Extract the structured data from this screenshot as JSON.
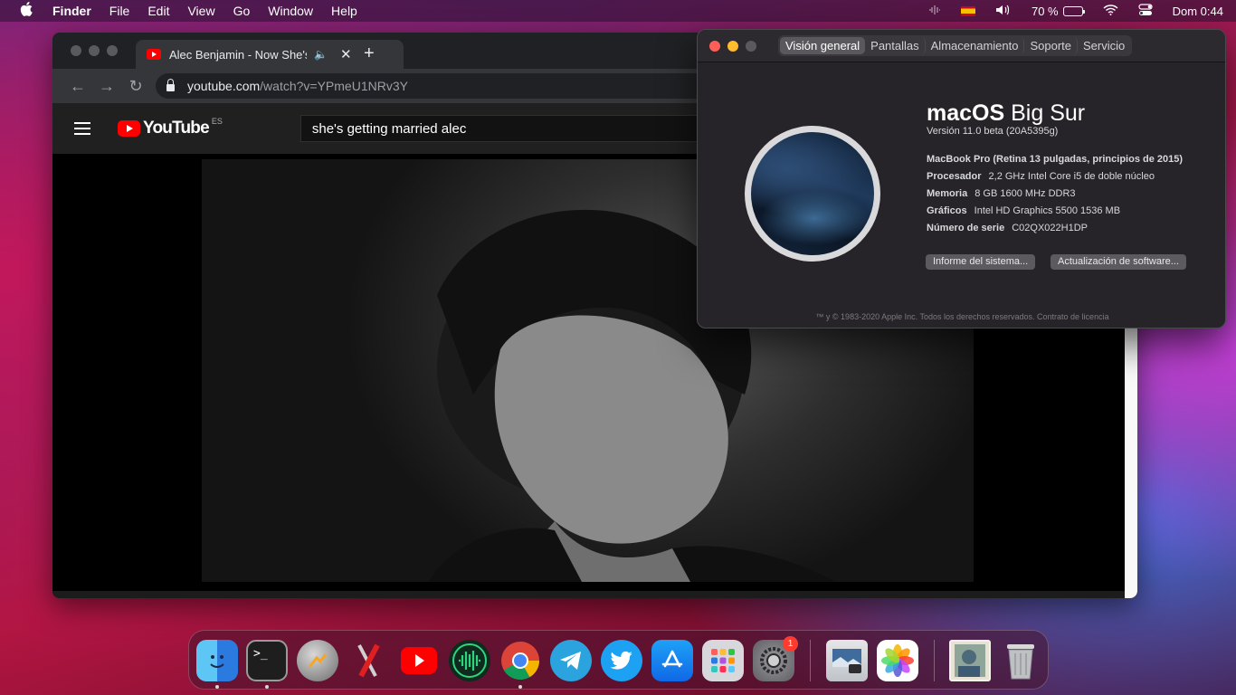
{
  "menubar": {
    "app_name": "Finder",
    "menus": [
      "File",
      "Edit",
      "View",
      "Go",
      "Window",
      "Help"
    ],
    "battery_percent": "70 %",
    "clock": "Dom 0:44"
  },
  "browser": {
    "tab_title": "Alec Benjamin - Now She's Getting Married",
    "new_tab_symbol": "+",
    "url_host": "youtube.com",
    "url_path": "/watch?v=YPmeU1NRv3Y",
    "youtube_wordmark": "YouTube",
    "youtube_region": "ES",
    "search_query": "she's getting married alec"
  },
  "about_mac": {
    "tabs": [
      "Visión general",
      "Pantallas",
      "Almacenamiento",
      "Soporte",
      "Servicio"
    ],
    "active_tab": "Visión general",
    "os_name_bold": "macOS",
    "os_name_light": "Big Sur",
    "version": "Versión 11.0 beta (20A5395g)",
    "model": "MacBook Pro (Retina 13 pulgadas, principios de 2015)",
    "specs": [
      {
        "key": "Procesador",
        "value": "2,2 GHz Intel Core i5 de doble núcleo"
      },
      {
        "key": "Memoria",
        "value": "8 GB 1600 MHz DDR3"
      },
      {
        "key": "Gráficos",
        "value": "Intel HD Graphics 5500 1536 MB"
      },
      {
        "key": "Número de serie",
        "value": "C02QX022H1DP"
      }
    ],
    "system_report_button": "Informe del sistema...",
    "software_update_button": "Actualización de software...",
    "copyright": "™ y © 1983-2020 Apple Inc. Todos los derechos reservados. Contrato de licencia"
  },
  "dock": {
    "apps": [
      "finder",
      "terminal",
      "disk-utility",
      "app-tool",
      "youtube",
      "audio-app",
      "chrome",
      "telegram",
      "twitter",
      "app-store",
      "launchpad",
      "system-preferences",
      "preview",
      "photos",
      "documents",
      "trash"
    ],
    "system_preferences_badge": "1"
  }
}
